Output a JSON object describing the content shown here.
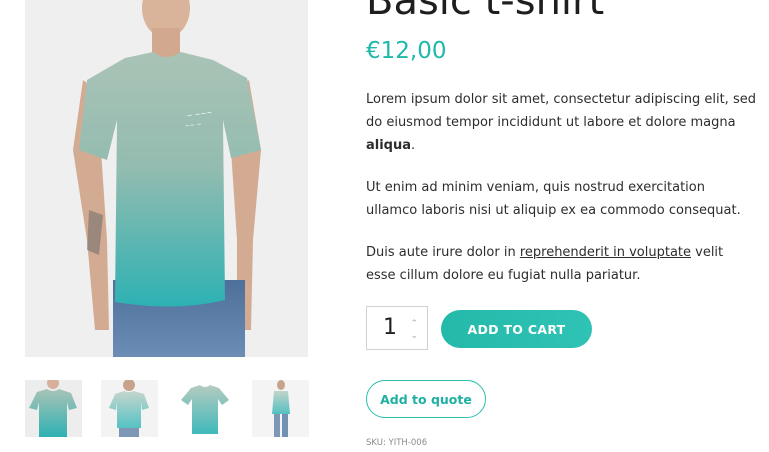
{
  "product": {
    "title": "Basic t-shirt",
    "price": "€12,00",
    "description": {
      "p1_text": "Lorem ipsum dolor sit amet, consectetur adipiscing elit, sed do eiusmod tempor incididunt ut labore et dolore magna ",
      "p1_bold": "aliqua",
      "p1_end": ".",
      "p2": "Ut enim ad minim veniam, quis nostrud exercitation ullamco laboris nisi ut aliquip ex ea commodo consequat.",
      "p3_start": "Duis aute irure dolor in ",
      "p3_link": "reprehenderit in voluptate",
      "p3_end": " velit esse cillum dolore eu fugiat nulla pariatur."
    },
    "quantity": "1",
    "add_to_cart_label": "ADD TO CART",
    "add_to_quote_label": "Add to quote",
    "sku_label": "SKU:",
    "sku_value": "YITH-006"
  },
  "gallery": {
    "main_image": "model-wearing-teal-gradient-tshirt",
    "thumbnails": [
      "front-view",
      "back-view",
      "flat-tshirt",
      "side-view"
    ]
  },
  "colors": {
    "accent": "#24b9a9",
    "shirt_top": "#a5c1b2",
    "shirt_bottom": "#2fb3b3"
  }
}
